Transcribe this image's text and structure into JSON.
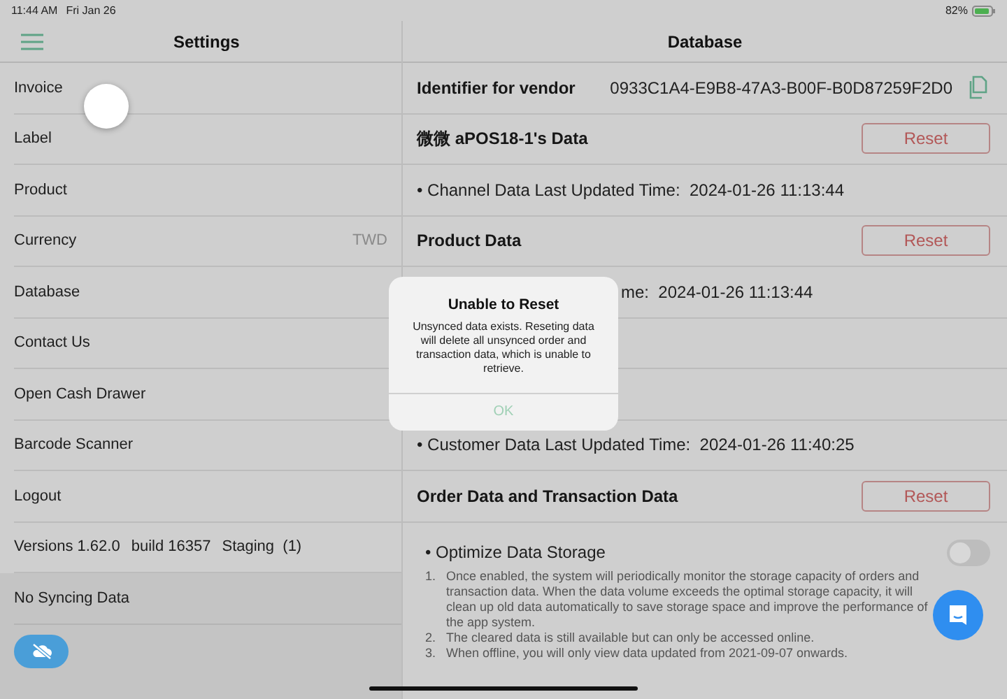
{
  "status_bar": {
    "time": "11:44 AM",
    "date": "Fri Jan 26",
    "battery": "82%"
  },
  "sidebar": {
    "title": "Settings",
    "items": [
      {
        "label": "Invoice"
      },
      {
        "label": "Label"
      },
      {
        "label": "Product"
      },
      {
        "label": "Currency",
        "value": "TWD"
      },
      {
        "label": "Database"
      },
      {
        "label": "Contact Us"
      },
      {
        "label": "Open Cash Drawer"
      },
      {
        "label": "Barcode Scanner"
      },
      {
        "label": "Logout"
      }
    ],
    "version": [
      "Versions 1.62.0",
      "build 16357",
      "Staging  (1)"
    ],
    "sync_panel": {
      "label": "No Syncing Data"
    }
  },
  "main": {
    "title": "Database",
    "rows": [
      {
        "kind": "identifier",
        "label": "Identifier for vendor",
        "value": "0933C1A4-E9B8-47A3-B00F-B0D87259F2D0"
      },
      {
        "kind": "section",
        "label": "微微 aPOS18-1's Data",
        "button": "Reset"
      },
      {
        "kind": "info",
        "text": "• Channel Data Last Updated Time:  2024-01-26 11:13:44"
      },
      {
        "kind": "section",
        "label": "Product Data",
        "button": "Reset"
      },
      {
        "kind": "partial",
        "text": "me:  2024-01-26 11:13:44"
      },
      {
        "kind": "blank"
      },
      {
        "kind": "blank"
      },
      {
        "kind": "info",
        "text": "• Customer Data Last Updated Time:  2024-01-26 11:40:25"
      },
      {
        "kind": "section",
        "label": "Order Data and Transaction Data",
        "button": "Reset"
      }
    ],
    "optimize": {
      "label": "• Optimize Data Storage",
      "on": false,
      "notes": [
        {
          "number": "1.",
          "text": "Once enabled, the system will periodically monitor the storage capacity of orders and transaction data. When the data volume exceeds the optimal storage capacity, it will clean up old data automatically to save storage space and improve the performance of the app system."
        },
        {
          "number": "2.",
          "text": "The cleared data is still available but can only be accessed online."
        },
        {
          "number": "3.",
          "text": "When offline, you will only view data updated from 2021-09-07 onwards."
        }
      ]
    }
  },
  "dialog": {
    "title": "Unable to Reset",
    "message": "Unsynced data exists. Reseting data will delete all unsynced order and transaction data, which is unable to retrieve.",
    "button": "OK"
  }
}
